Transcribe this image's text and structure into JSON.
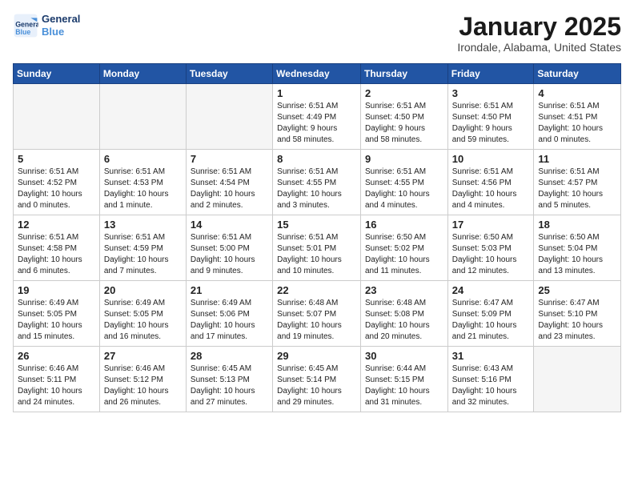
{
  "header": {
    "logo_line1": "General",
    "logo_line2": "Blue",
    "month": "January 2025",
    "location": "Irondale, Alabama, United States"
  },
  "weekdays": [
    "Sunday",
    "Monday",
    "Tuesday",
    "Wednesday",
    "Thursday",
    "Friday",
    "Saturday"
  ],
  "weeks": [
    [
      {
        "day": "",
        "text": ""
      },
      {
        "day": "",
        "text": ""
      },
      {
        "day": "",
        "text": ""
      },
      {
        "day": "1",
        "text": "Sunrise: 6:51 AM\nSunset: 4:49 PM\nDaylight: 9 hours\nand 58 minutes."
      },
      {
        "day": "2",
        "text": "Sunrise: 6:51 AM\nSunset: 4:50 PM\nDaylight: 9 hours\nand 58 minutes."
      },
      {
        "day": "3",
        "text": "Sunrise: 6:51 AM\nSunset: 4:50 PM\nDaylight: 9 hours\nand 59 minutes."
      },
      {
        "day": "4",
        "text": "Sunrise: 6:51 AM\nSunset: 4:51 PM\nDaylight: 10 hours\nand 0 minutes."
      }
    ],
    [
      {
        "day": "5",
        "text": "Sunrise: 6:51 AM\nSunset: 4:52 PM\nDaylight: 10 hours\nand 0 minutes."
      },
      {
        "day": "6",
        "text": "Sunrise: 6:51 AM\nSunset: 4:53 PM\nDaylight: 10 hours\nand 1 minute."
      },
      {
        "day": "7",
        "text": "Sunrise: 6:51 AM\nSunset: 4:54 PM\nDaylight: 10 hours\nand 2 minutes."
      },
      {
        "day": "8",
        "text": "Sunrise: 6:51 AM\nSunset: 4:55 PM\nDaylight: 10 hours\nand 3 minutes."
      },
      {
        "day": "9",
        "text": "Sunrise: 6:51 AM\nSunset: 4:55 PM\nDaylight: 10 hours\nand 4 minutes."
      },
      {
        "day": "10",
        "text": "Sunrise: 6:51 AM\nSunset: 4:56 PM\nDaylight: 10 hours\nand 4 minutes."
      },
      {
        "day": "11",
        "text": "Sunrise: 6:51 AM\nSunset: 4:57 PM\nDaylight: 10 hours\nand 5 minutes."
      }
    ],
    [
      {
        "day": "12",
        "text": "Sunrise: 6:51 AM\nSunset: 4:58 PM\nDaylight: 10 hours\nand 6 minutes."
      },
      {
        "day": "13",
        "text": "Sunrise: 6:51 AM\nSunset: 4:59 PM\nDaylight: 10 hours\nand 7 minutes."
      },
      {
        "day": "14",
        "text": "Sunrise: 6:51 AM\nSunset: 5:00 PM\nDaylight: 10 hours\nand 9 minutes."
      },
      {
        "day": "15",
        "text": "Sunrise: 6:51 AM\nSunset: 5:01 PM\nDaylight: 10 hours\nand 10 minutes."
      },
      {
        "day": "16",
        "text": "Sunrise: 6:50 AM\nSunset: 5:02 PM\nDaylight: 10 hours\nand 11 minutes."
      },
      {
        "day": "17",
        "text": "Sunrise: 6:50 AM\nSunset: 5:03 PM\nDaylight: 10 hours\nand 12 minutes."
      },
      {
        "day": "18",
        "text": "Sunrise: 6:50 AM\nSunset: 5:04 PM\nDaylight: 10 hours\nand 13 minutes."
      }
    ],
    [
      {
        "day": "19",
        "text": "Sunrise: 6:49 AM\nSunset: 5:05 PM\nDaylight: 10 hours\nand 15 minutes."
      },
      {
        "day": "20",
        "text": "Sunrise: 6:49 AM\nSunset: 5:05 PM\nDaylight: 10 hours\nand 16 minutes."
      },
      {
        "day": "21",
        "text": "Sunrise: 6:49 AM\nSunset: 5:06 PM\nDaylight: 10 hours\nand 17 minutes."
      },
      {
        "day": "22",
        "text": "Sunrise: 6:48 AM\nSunset: 5:07 PM\nDaylight: 10 hours\nand 19 minutes."
      },
      {
        "day": "23",
        "text": "Sunrise: 6:48 AM\nSunset: 5:08 PM\nDaylight: 10 hours\nand 20 minutes."
      },
      {
        "day": "24",
        "text": "Sunrise: 6:47 AM\nSunset: 5:09 PM\nDaylight: 10 hours\nand 21 minutes."
      },
      {
        "day": "25",
        "text": "Sunrise: 6:47 AM\nSunset: 5:10 PM\nDaylight: 10 hours\nand 23 minutes."
      }
    ],
    [
      {
        "day": "26",
        "text": "Sunrise: 6:46 AM\nSunset: 5:11 PM\nDaylight: 10 hours\nand 24 minutes."
      },
      {
        "day": "27",
        "text": "Sunrise: 6:46 AM\nSunset: 5:12 PM\nDaylight: 10 hours\nand 26 minutes."
      },
      {
        "day": "28",
        "text": "Sunrise: 6:45 AM\nSunset: 5:13 PM\nDaylight: 10 hours\nand 27 minutes."
      },
      {
        "day": "29",
        "text": "Sunrise: 6:45 AM\nSunset: 5:14 PM\nDaylight: 10 hours\nand 29 minutes."
      },
      {
        "day": "30",
        "text": "Sunrise: 6:44 AM\nSunset: 5:15 PM\nDaylight: 10 hours\nand 31 minutes."
      },
      {
        "day": "31",
        "text": "Sunrise: 6:43 AM\nSunset: 5:16 PM\nDaylight: 10 hours\nand 32 minutes."
      },
      {
        "day": "",
        "text": ""
      }
    ]
  ]
}
